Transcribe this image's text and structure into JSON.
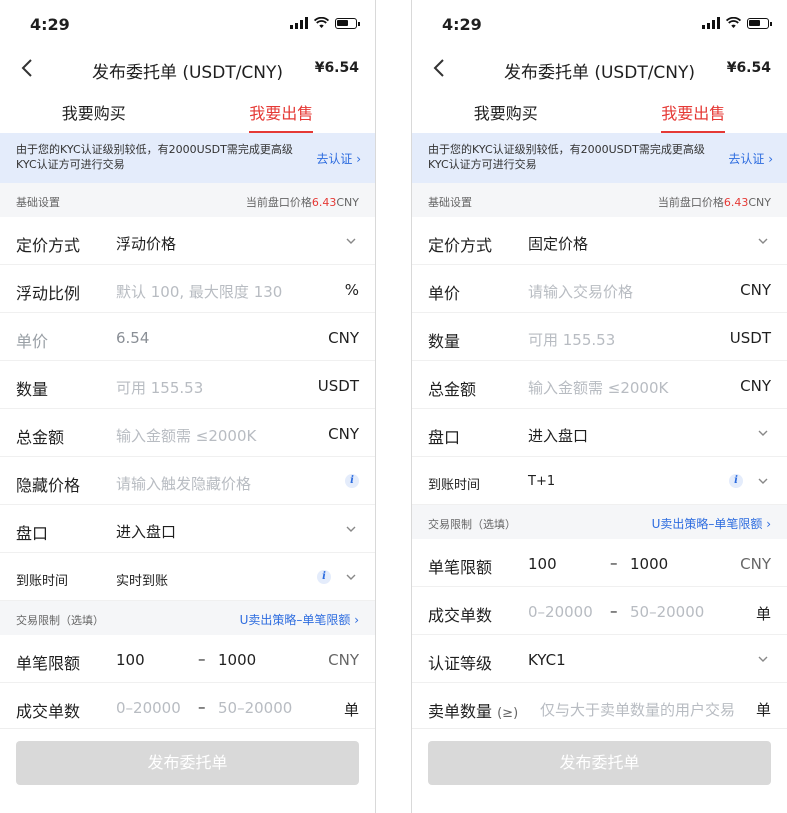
{
  "status_bar": {
    "time": "4:29"
  },
  "nav": {
    "title": "发布委托单 (USDT/CNY)",
    "price": "¥6.54"
  },
  "tabs": [
    {
      "label": "我要购买"
    },
    {
      "label": "我要出售"
    }
  ],
  "notice": {
    "text": "由于您的KYC认证级别较低，有2000USDT需完成更高级KYC认证方可进行交易",
    "link": "去认证 ›"
  },
  "sections": {
    "basic": {
      "title": "基础设置",
      "market_price_label": "当前盘口价格",
      "market_price_value": "6.43",
      "market_price_unit": "CNY"
    },
    "limits": {
      "title": "交易限制（选填）",
      "link": "U卖出策略–单笔限额 ›"
    }
  },
  "left": {
    "pricing": {
      "label": "定价方式",
      "value": "浮动价格"
    },
    "float_ratio": {
      "label": "浮动比例",
      "placeholder": "默认 100, 最大限度 130",
      "unit": "%"
    },
    "unit_price": {
      "label": "单价",
      "value": "6.54",
      "unit": "CNY"
    },
    "quantity": {
      "label": "数量",
      "placeholder": "可用 155.53",
      "unit": "USDT"
    },
    "total": {
      "label": "总金额",
      "placeholder": "输入金额需 ≤2000K",
      "unit": "CNY"
    },
    "hidden_price": {
      "label": "隐藏价格",
      "placeholder": "请输入触发隐藏价格"
    },
    "market": {
      "label": "盘口",
      "value": "进入盘口"
    },
    "arrival": {
      "label": "到账时间",
      "value": "实时到账"
    },
    "single_limit": {
      "label": "单笔限额",
      "min": "100",
      "dash": "–",
      "max": "1000",
      "unit": "CNY"
    },
    "deal_count": {
      "label": "成交单数",
      "min": "0–20000",
      "dash": "–",
      "max": "50–20000",
      "unit": "单"
    }
  },
  "right": {
    "pricing": {
      "label": "定价方式",
      "value": "固定价格"
    },
    "unit_price": {
      "label": "单价",
      "placeholder": "请输入交易价格",
      "unit": "CNY"
    },
    "quantity": {
      "label": "数量",
      "placeholder": "可用 155.53",
      "unit": "USDT"
    },
    "total": {
      "label": "总金额",
      "placeholder": "输入金额需 ≤2000K",
      "unit": "CNY"
    },
    "market": {
      "label": "盘口",
      "value": "进入盘口"
    },
    "arrival": {
      "label": "到账时间",
      "value": "T+1"
    },
    "single_limit": {
      "label": "单笔限额",
      "min": "100",
      "dash": "–",
      "max": "1000",
      "unit": "CNY"
    },
    "deal_count": {
      "label": "成交单数",
      "min": "0–20000",
      "dash": "–",
      "max": "50–20000",
      "unit": "单"
    },
    "kyc_level": {
      "label": "认证等级",
      "value": "KYC1"
    },
    "sell_count": {
      "label": "卖单数量",
      "label_suffix": "(≥)",
      "placeholder": "仅与大于卖单数量的用户交易",
      "unit": "单"
    }
  },
  "footer": {
    "publish_label": "发布委托单"
  },
  "colors": {
    "accent_red": "#e53935",
    "link_blue": "#2d6cdf",
    "notice_bg": "#e4ecfb",
    "disabled_button": "#d9d9d9"
  }
}
